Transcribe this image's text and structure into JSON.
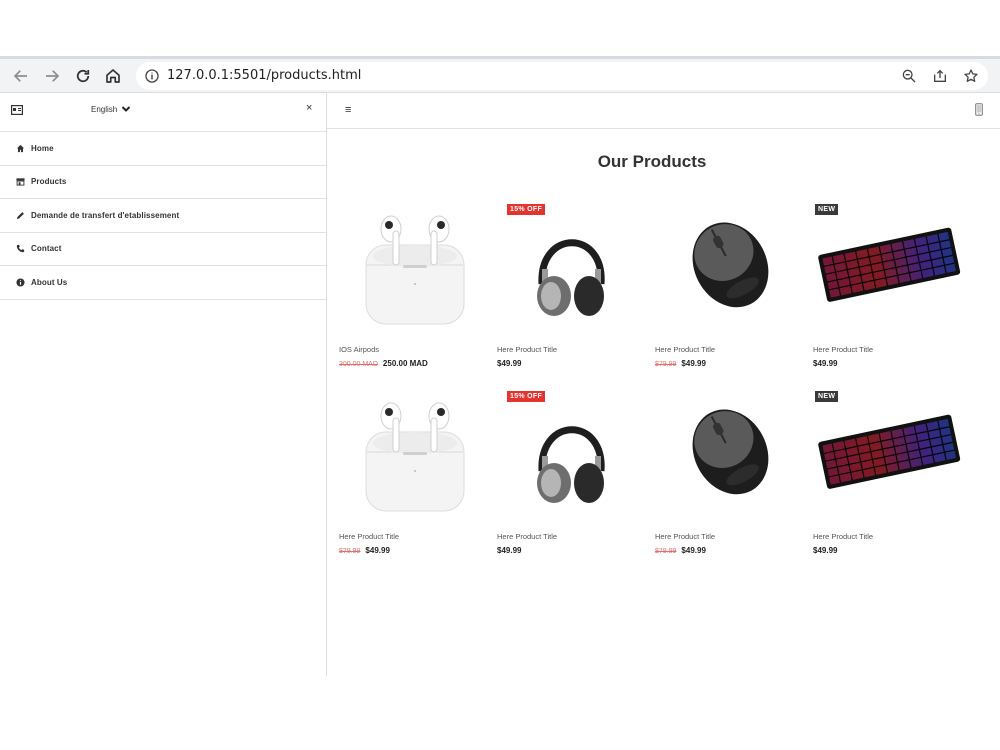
{
  "browser": {
    "url": "127.0.0.1:5501/products.html"
  },
  "sidebar": {
    "language": "English",
    "close_label": "×",
    "items": [
      {
        "label": "Home",
        "icon": "home-icon"
      },
      {
        "label": "Products",
        "icon": "store-icon"
      },
      {
        "label": "Demande de transfert d'etablissement",
        "icon": "pencil-icon"
      },
      {
        "label": "Contact",
        "icon": "phone-icon"
      },
      {
        "label": "About Us",
        "icon": "info-icon"
      }
    ]
  },
  "main": {
    "menu_label": "≡",
    "title": "Our Products",
    "products": [
      {
        "title": "IOS Airpods",
        "old_price": "300.00 MAD",
        "price": "250.00 MAD",
        "badge": "",
        "image": "airpods"
      },
      {
        "title": "Here Product Title",
        "old_price": "",
        "price": "$49.99",
        "badge": "15% OFF",
        "image": "headphones"
      },
      {
        "title": "Here Product Title",
        "old_price": "$79.99",
        "price": "$49.99",
        "badge": "",
        "image": "mouse"
      },
      {
        "title": "Here Product Title",
        "old_price": "",
        "price": "$49.99",
        "badge": "NEW",
        "image": "keyboard"
      },
      {
        "title": "Here Product Title",
        "old_price": "$79.99",
        "price": "$49.99",
        "badge": "",
        "image": "airpods"
      },
      {
        "title": "Here Product Title",
        "old_price": "",
        "price": "$49.99",
        "badge": "15% OFF",
        "image": "headphones"
      },
      {
        "title": "Here Product Title",
        "old_price": "$79.99",
        "price": "$49.99",
        "badge": "",
        "image": "mouse"
      },
      {
        "title": "Here Product Title",
        "old_price": "",
        "price": "$49.99",
        "badge": "NEW",
        "image": "keyboard"
      }
    ]
  },
  "colors": {
    "badge_off": "#e3342f",
    "badge_new": "#3a3a3a",
    "old_price": "#e07070"
  }
}
